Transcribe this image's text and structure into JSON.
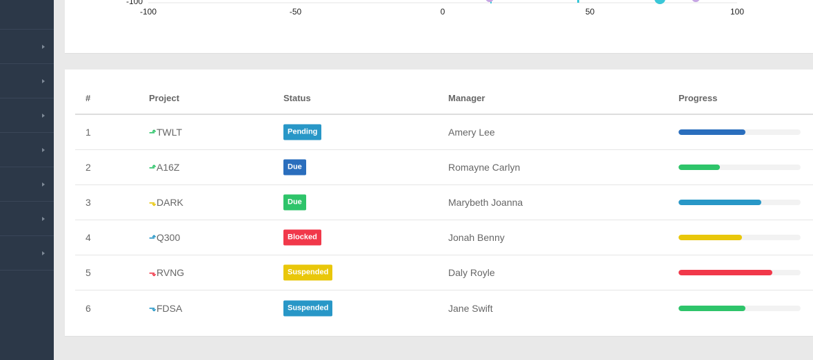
{
  "colors": {
    "blue": "#2a6ebd",
    "green": "#2ec46a",
    "teal": "#2897c7",
    "yellow": "#e9c70a",
    "red": "#f1384a",
    "sidebar": "#2c3848"
  },
  "chart": {
    "y_tick_label": "-100",
    "x_ticks": [
      {
        "value": -100,
        "label": "-100"
      },
      {
        "value": -50,
        "label": "-50"
      },
      {
        "value": 0,
        "label": "0"
      },
      {
        "value": 50,
        "label": "50"
      },
      {
        "value": 100,
        "label": "100"
      }
    ]
  },
  "sidebar": {
    "item_count": 7,
    "chevron_icon": "chevron-right-icon"
  },
  "table": {
    "headers": {
      "num": "#",
      "project": "Project",
      "status": "Status",
      "manager": "Manager",
      "progress": "Progress"
    },
    "rows": [
      {
        "num": "1",
        "project": "TWLT",
        "trend": "up",
        "trend_color": "#2ec46a",
        "status": "Pending",
        "status_color": "#2897c7",
        "manager": "Amery Lee",
        "progress": 55,
        "progress_color": "#2a6ebd"
      },
      {
        "num": "2",
        "project": "A16Z",
        "trend": "up",
        "trend_color": "#2ec46a",
        "status": "Due",
        "status_color": "#2a6ebd",
        "manager": "Romayne Carlyn",
        "progress": 34,
        "progress_color": "#2ec46a"
      },
      {
        "num": "3",
        "project": "DARK",
        "trend": "down",
        "trend_color": "#e9c70a",
        "status": "Due",
        "status_color": "#2ec46a",
        "manager": "Marybeth Joanna",
        "progress": 68,
        "progress_color": "#2897c7"
      },
      {
        "num": "4",
        "project": "Q300",
        "trend": "up",
        "trend_color": "#2897c7",
        "status": "Blocked",
        "status_color": "#f1384a",
        "manager": "Jonah Benny",
        "progress": 52,
        "progress_color": "#e9c70a"
      },
      {
        "num": "5",
        "project": "RVNG",
        "trend": "down",
        "trend_color": "#f1384a",
        "status": "Suspended",
        "status_color": "#e9c70a",
        "manager": "Daly Royle",
        "progress": 77,
        "progress_color": "#f1384a"
      },
      {
        "num": "6",
        "project": "FDSA",
        "trend": "down",
        "trend_color": "#2897c7",
        "status": "Suspended",
        "status_color": "#2897c7",
        "manager": "Jane Swift",
        "progress": 55,
        "progress_color": "#2ec46a"
      }
    ]
  }
}
